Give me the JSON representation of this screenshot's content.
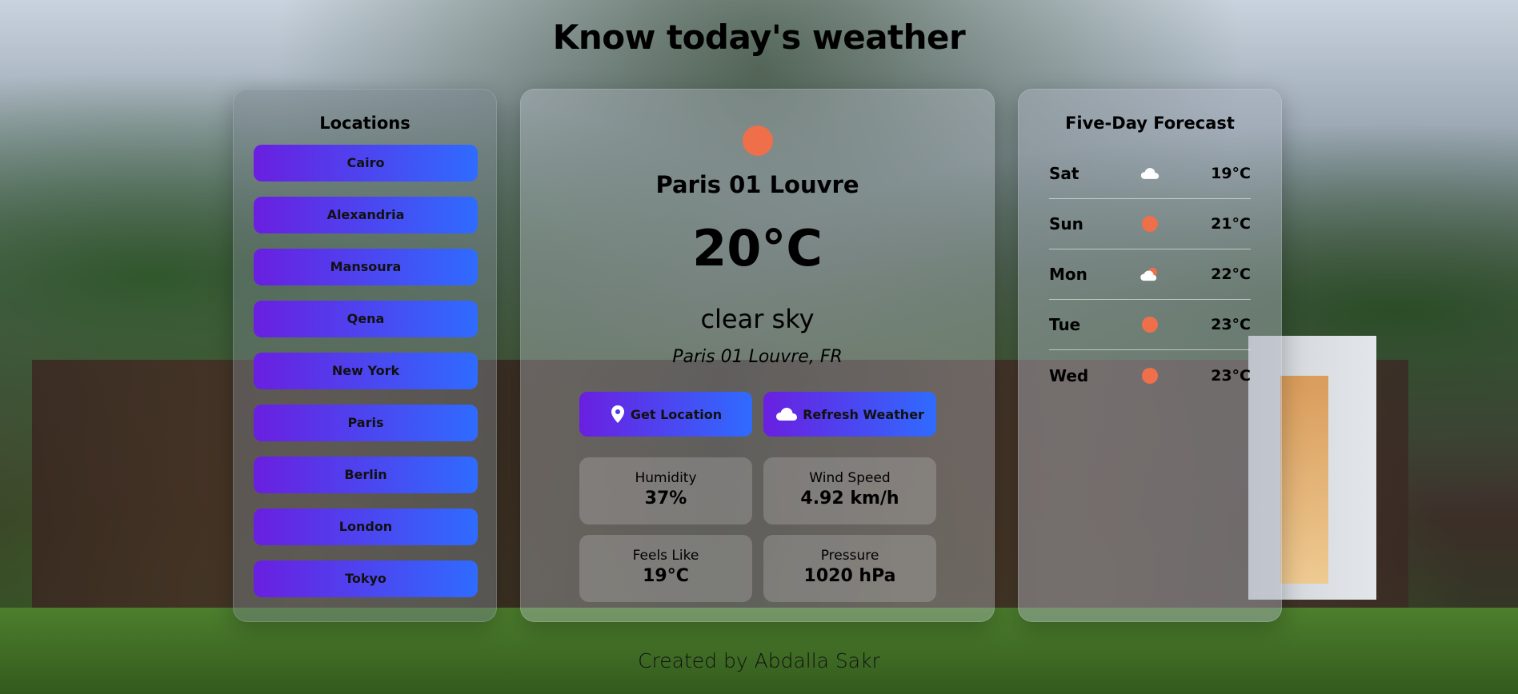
{
  "page": {
    "title": "Know today's weather",
    "footer": "Created by Abdalla Sakr"
  },
  "locations": {
    "title": "Locations",
    "items": [
      "Cairo",
      "Alexandria",
      "Mansoura",
      "Qena",
      "New York",
      "Paris",
      "Berlin",
      "London",
      "Tokyo"
    ]
  },
  "current": {
    "icon": "sun-icon",
    "city": "Paris 01 Louvre",
    "temperature": "20°C",
    "condition": "clear sky",
    "place": "Paris 01 Louvre, FR",
    "buttons": {
      "get_location": "Get Location",
      "refresh": "Refresh Weather"
    },
    "stats": [
      {
        "label": "Humidity",
        "value": "37%"
      },
      {
        "label": "Wind Speed",
        "value": "4.92 km/h"
      },
      {
        "label": "Feels Like",
        "value": "19°C"
      },
      {
        "label": "Pressure",
        "value": "1020 hPa"
      }
    ]
  },
  "forecast": {
    "title": "Five-Day Forecast",
    "days": [
      {
        "day": "Sat",
        "icon": "cloud-icon",
        "temp": "19°C"
      },
      {
        "day": "Sun",
        "icon": "sun-icon",
        "temp": "21°C"
      },
      {
        "day": "Mon",
        "icon": "partly-cloudy-icon",
        "temp": "22°C"
      },
      {
        "day": "Tue",
        "icon": "sun-icon",
        "temp": "23°C"
      },
      {
        "day": "Wed",
        "icon": "sun-icon",
        "temp": "23°C"
      }
    ]
  },
  "colors": {
    "accent_start": "#6a1fe0",
    "accent_end": "#2f6bff",
    "sun": "#ef6f4a"
  }
}
